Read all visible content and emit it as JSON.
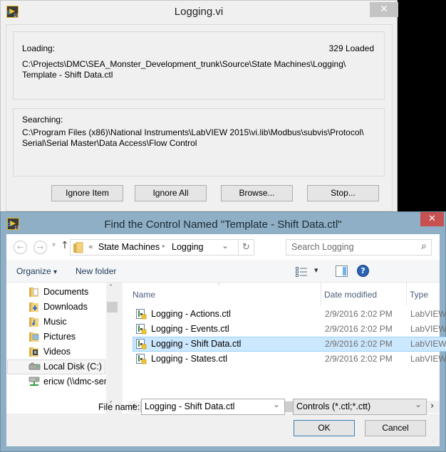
{
  "loading_dialog": {
    "title": "Logging.vi",
    "close_glyph": "✕",
    "loading_label": "Loading:",
    "loaded_count": "329 Loaded",
    "loading_path_line1": "C:\\Projects\\DMC\\SEA_Monster_Development_trunk\\Source\\State Machines\\Logging\\",
    "loading_path_line2": "Template - Shift Data.ctl",
    "searching_label": "Searching:",
    "searching_path_line1": "C:\\Program Files (x86)\\National Instruments\\LabVIEW 2015\\vi.lib\\Modbus\\subvis\\Protocol\\",
    "searching_path_line2": "Serial\\Serial Master\\Data Access\\Flow Control",
    "buttons": {
      "ignore_item": "Ignore Item",
      "ignore_all": "Ignore All",
      "browse": "Browse...",
      "stop": "Stop..."
    }
  },
  "find_dialog": {
    "title": "Find the Control Named \"Template - Shift Data.ctl\"",
    "close_glyph": "✕",
    "nav": {
      "back_glyph": "←",
      "forward_glyph": "→",
      "recent_glyph": "▾",
      "up_glyph": "↑",
      "breadcrumb_overflow": "«",
      "breadcrumb": [
        "State Machines",
        "Logging"
      ],
      "breadcrumb_sep": "▸",
      "dropdown_glyph": "⌄",
      "refresh_glyph": "↻",
      "search_placeholder": "Search Logging",
      "search_glyph": "⌕"
    },
    "toolbar": {
      "organize": "Organize",
      "organize_caret": "▾",
      "new_folder": "New folder",
      "view_caret": "▾",
      "help_glyph": "?"
    },
    "nav_pane": {
      "items": [
        {
          "label": "Documents",
          "icon": "documents-folder-icon"
        },
        {
          "label": "Downloads",
          "icon": "downloads-folder-icon"
        },
        {
          "label": "Music",
          "icon": "music-folder-icon"
        },
        {
          "label": "Pictures",
          "icon": "pictures-folder-icon"
        },
        {
          "label": "Videos",
          "icon": "videos-folder-icon"
        },
        {
          "label": "Local Disk (C:)",
          "icon": "local-disk-icon",
          "selected": true
        },
        {
          "label": "ericw (\\\\dmc-ser",
          "icon": "network-drive-icon"
        }
      ],
      "scroll_up": "˄",
      "scroll_down": "˅"
    },
    "file_list": {
      "columns": [
        "Name",
        "Date modified",
        "Type"
      ],
      "sort_glyph": "˄",
      "rows": [
        {
          "name": "Logging - Actions.ctl",
          "date": "2/9/2016 2:02 PM",
          "type": "LabVIEW C"
        },
        {
          "name": "Logging - Events.ctl",
          "date": "2/9/2016 2:02 PM",
          "type": "LabVIEW C"
        },
        {
          "name": "Logging - Shift Data.ctl",
          "date": "2/9/2016 2:02 PM",
          "type": "LabVIEW C",
          "selected": true
        },
        {
          "name": "Logging - States.ctl",
          "date": "2/9/2016 2:02 PM",
          "type": "LabVIEW C"
        }
      ],
      "scroll_left": "‹",
      "scroll_right": "›"
    },
    "footer": {
      "file_name_label": "File name:",
      "file_name_value": "Logging - Shift Data.ctl",
      "file_type_value": "Controls (*.ctl;*.ctt)",
      "combo_glyph": "⌄",
      "ok": "OK",
      "cancel": "Cancel"
    },
    "colors": {
      "frame": "#8eafc5",
      "close": "#c75050",
      "selection": "#cce8ff",
      "selection_border": "#99d1ff"
    }
  }
}
